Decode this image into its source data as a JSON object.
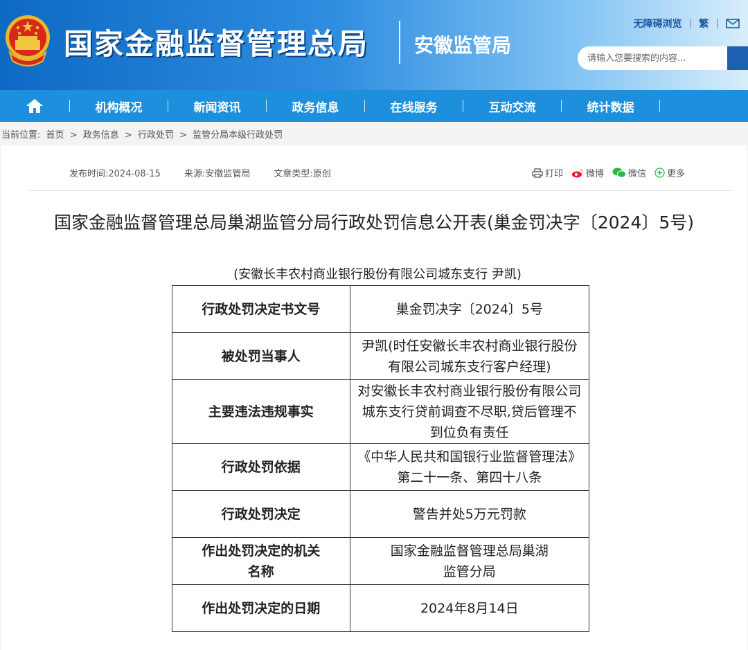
{
  "header": {
    "site_title": "国家金融监督管理总局",
    "sub_title": "安徽监管局",
    "links": {
      "accessibility": "无障碍浏览",
      "traditional": "繁"
    },
    "search_placeholder": "请输入您要搜索的内容...",
    "brand_color": "#1e8fdc"
  },
  "nav": {
    "items": [
      "机构概况",
      "新闻资讯",
      "政务信息",
      "在线服务",
      "互动交流",
      "统计数据"
    ]
  },
  "breadcrumb": {
    "label": "当前位置:",
    "items": [
      "首页",
      "政务信息",
      "行政处罚",
      "监管分局本级行政处罚"
    ],
    "separator": ">"
  },
  "meta": {
    "publish_time": "发布时间:2024-08-15",
    "source": "来源:安徽监管局",
    "doc_type": "文章类型:原创"
  },
  "share": {
    "print": "打印",
    "weibo": "微博",
    "wechat": "微信",
    "more": "更多"
  },
  "document": {
    "title": "国家金融监督管理总局巢湖监管分局行政处罚信息公开表(巢金罚决字〔2024〕5号)",
    "subtitle": "(安徽长丰农村商业银行股份有限公司城东支行 尹凯)",
    "rows": [
      {
        "label": "行政处罚决定书文号",
        "value": "巢金罚决字〔2024〕5号"
      },
      {
        "label": "被处罚当事人",
        "value": "尹凯(时任安徽长丰农村商业银行股份有限公司城东支行客户经理)"
      },
      {
        "label": "主要违法违规事实",
        "value": "对安徽长丰农村商业银行股份有限公司城东支行贷前调查不尽职,贷后管理不到位负有责任"
      },
      {
        "label": "行政处罚依据",
        "value": "《中华人民共和国银行业监督管理法》第二十一条、第四十八条"
      },
      {
        "label": "行政处罚决定",
        "value": "警告并处5万元罚款"
      },
      {
        "label": "作出处罚决定的机关名称",
        "value": "国家金融监督管理总局巢湖监管分局"
      },
      {
        "label": "作出处罚决定的日期",
        "value": "2024年8月14日"
      }
    ]
  }
}
